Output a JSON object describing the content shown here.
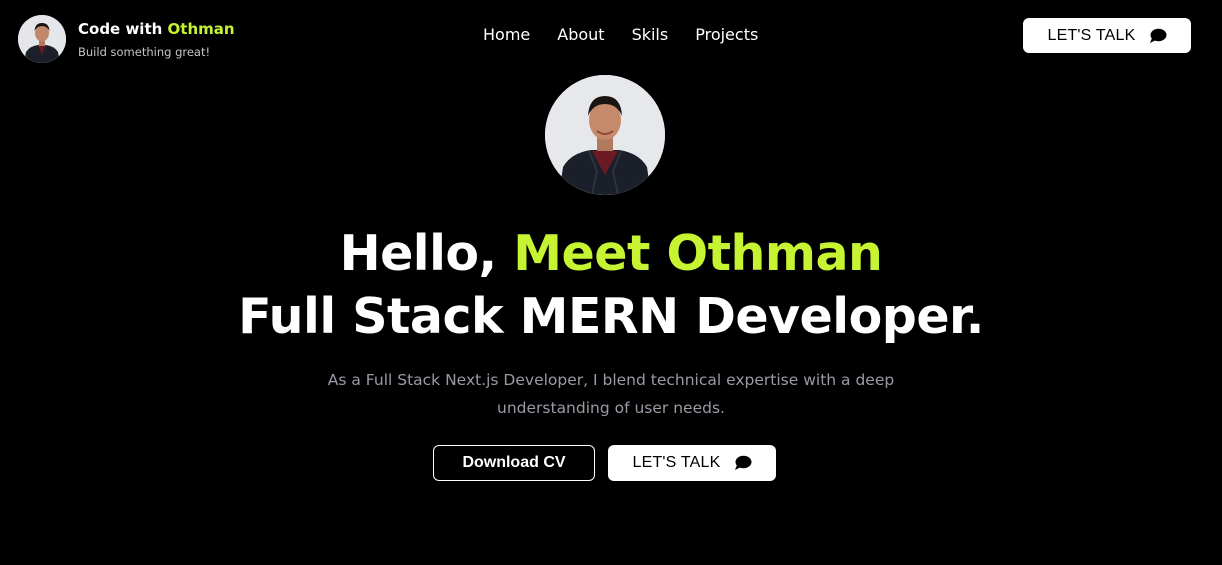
{
  "brand": {
    "title_prefix": "Code with",
    "title_accent": "Othman",
    "tagline": "Build something great!"
  },
  "nav": {
    "items": [
      "Home",
      "About",
      "Skils",
      "Projects"
    ]
  },
  "header_cta": {
    "label": "LET'S TALK",
    "icon": "chat-bubble-icon"
  },
  "hero": {
    "greeting": "Hello,",
    "name": "Meet Othman",
    "role": "Full Stack MERN Developer.",
    "description": "As a Full Stack Next.js Developer, I blend technical expertise with a deep understanding of user needs.",
    "download_button": "Download CV",
    "talk_button": "LET'S TALK"
  },
  "colors": {
    "background": "#000000",
    "accent": "#c6f432",
    "text": "#ffffff",
    "muted_text": "#9a9aa6"
  }
}
